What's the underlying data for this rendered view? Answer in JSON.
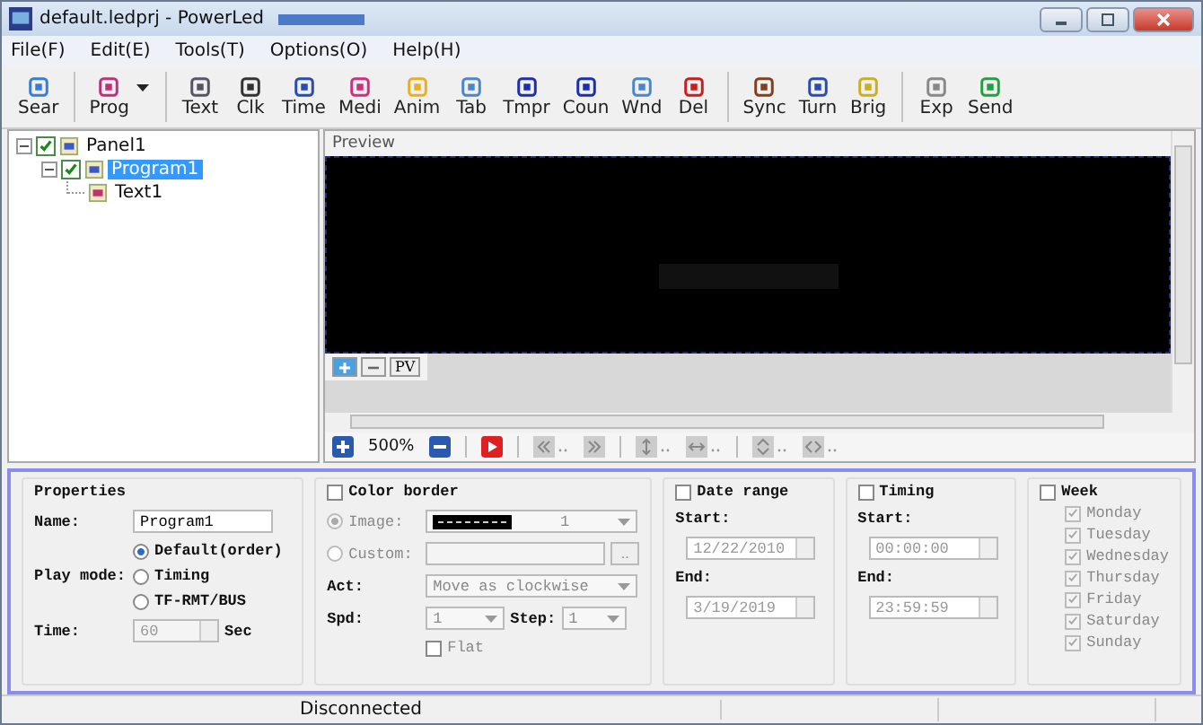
{
  "window": {
    "title": "default.ledprj - PowerLed"
  },
  "menu": [
    "File(F)",
    "Edit(E)",
    "Tools(T)",
    "Options(O)",
    "Help(H)"
  ],
  "toolbar": [
    [
      {
        "label": "Sear",
        "kind": "button"
      }
    ],
    [
      {
        "label": "Prog",
        "kind": "dropdown"
      }
    ],
    [
      {
        "label": "Text",
        "kind": "button"
      },
      {
        "label": "Clk",
        "kind": "button"
      },
      {
        "label": "Time",
        "kind": "button"
      },
      {
        "label": "Medi",
        "kind": "button"
      },
      {
        "label": "Anim",
        "kind": "button"
      },
      {
        "label": "Tab",
        "kind": "button"
      },
      {
        "label": "Tmpr",
        "kind": "button"
      },
      {
        "label": "Coun",
        "kind": "button"
      },
      {
        "label": "Wnd",
        "kind": "button"
      },
      {
        "label": "Del",
        "kind": "button"
      }
    ],
    [
      {
        "label": "Sync",
        "kind": "button"
      },
      {
        "label": "Turn",
        "kind": "button"
      },
      {
        "label": "Brig",
        "kind": "button"
      }
    ],
    [
      {
        "label": "Exp",
        "kind": "button"
      },
      {
        "label": "Send",
        "kind": "button"
      }
    ]
  ],
  "tree": [
    {
      "label": "Panel1",
      "checked": true,
      "expanded": true,
      "selected": false,
      "children": [
        {
          "label": "Program1",
          "checked": true,
          "expanded": true,
          "selected": true,
          "children": [
            {
              "label": "Text1",
              "selected": false
            }
          ]
        }
      ]
    }
  ],
  "preview": {
    "title": "Preview",
    "pv_button": "PV",
    "zoom": "500%"
  },
  "properties": {
    "title": "Properties",
    "name_label": "Name:",
    "name": "Program1",
    "play_mode_label": "Play mode:",
    "play_modes": [
      {
        "label": "Default(order)",
        "selected": true
      },
      {
        "label": "Timing",
        "selected": false
      },
      {
        "label": "TF-RMT/BUS",
        "selected": false
      }
    ],
    "time_label": "Time:",
    "time": "60",
    "time_unit": "Sec"
  },
  "color_border": {
    "label": "Color border",
    "checked": false,
    "options": [
      {
        "label": "Image:",
        "selected": true
      },
      {
        "label": "Custom:",
        "selected": false
      }
    ],
    "image_value": "1",
    "custom_button": "..",
    "act_label": "Act:",
    "act": "Move as clockwise",
    "spd_label": "Spd:",
    "spd": "1",
    "step_label": "Step:",
    "step": "1",
    "flat": {
      "label": "Flat",
      "checked": false
    }
  },
  "date_range": {
    "label": "Date range",
    "checked": false,
    "start_label": "Start:",
    "start": "12/22/2010",
    "end_label": "End:",
    "end": "3/19/2019"
  },
  "timing": {
    "label": "Timing",
    "checked": false,
    "start_label": "Start:",
    "start": "00:00:00",
    "end_label": "End:",
    "end": "23:59:59"
  },
  "week": {
    "label": "Week",
    "checked": false,
    "days": [
      {
        "label": "Monday",
        "checked": true
      },
      {
        "label": "Tuesday",
        "checked": true
      },
      {
        "label": "Wednesday",
        "checked": true
      },
      {
        "label": "Thursday",
        "checked": true
      },
      {
        "label": "Friday",
        "checked": true
      },
      {
        "label": "Saturday",
        "checked": true
      },
      {
        "label": "Sunday",
        "checked": true
      }
    ]
  },
  "status_bar": "Disconnected"
}
